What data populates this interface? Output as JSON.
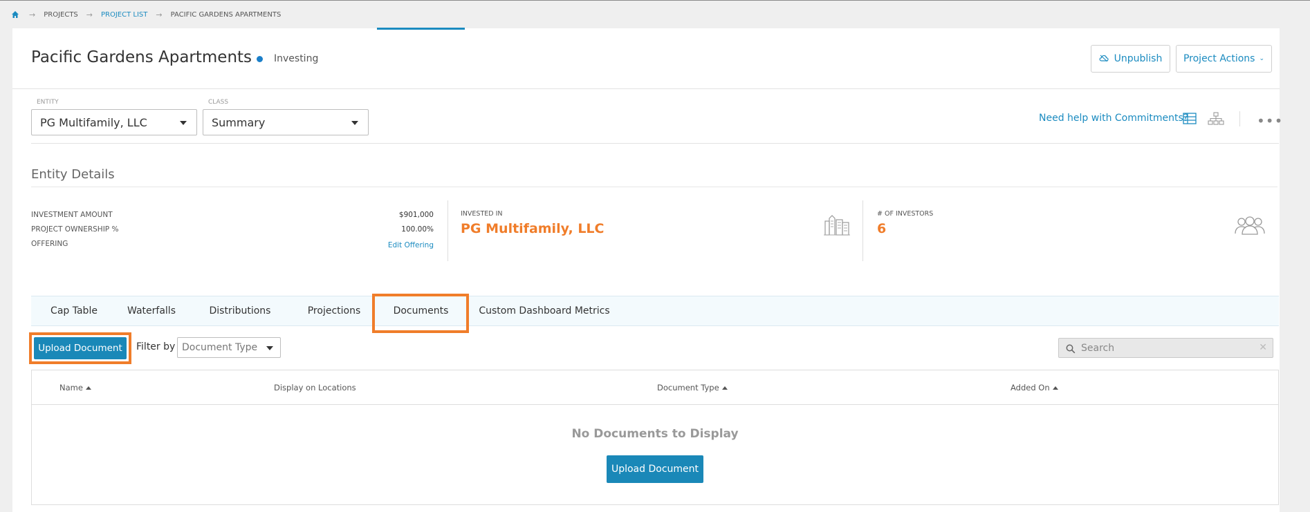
{
  "breadcrumb": {
    "projects": "PROJECTS",
    "project_list": "PROJECT LIST",
    "current": "PACIFIC GARDENS APARTMENTS"
  },
  "header": {
    "title": "Pacific Gardens Apartments",
    "status": "Investing",
    "unpublish": "Unpublish",
    "project_actions": "Project Actions"
  },
  "filters": {
    "entity_label": "ENTITY",
    "entity_value": "PG Multifamily, LLC",
    "class_label": "CLASS",
    "class_value": "Summary"
  },
  "help_link": "Need help with Commitments?",
  "entity_details": {
    "heading": "Entity Details",
    "investment_amount_label": "INVESTMENT AMOUNT",
    "investment_amount": "$901,000",
    "ownership_label": "PROJECT OWNERSHIP %",
    "ownership": "100.00%",
    "offering_label": "OFFERING",
    "edit_offering": "Edit Offering",
    "invested_in_label": "INVESTED IN",
    "invested_in": "PG Multifamily, LLC",
    "investors_label": "# OF INVESTORS",
    "investors": "6"
  },
  "tabs": [
    "Cap Table",
    "Waterfalls",
    "Distributions",
    "Projections",
    "Documents",
    "Custom Dashboard Metrics"
  ],
  "documents": {
    "upload_button": "Upload Document",
    "filter_by": "Filter by",
    "doc_type_placeholder": "Document Type",
    "search_placeholder": "Search",
    "columns": [
      "Name",
      "Display on Locations",
      "Document Type",
      "Added On"
    ],
    "empty_message": "No Documents to Display",
    "empty_upload_button": "Upload Document"
  },
  "colors": {
    "accent": "#1b8bc0",
    "orange": "#f07d2a",
    "primary_button": "#1a88b8"
  }
}
